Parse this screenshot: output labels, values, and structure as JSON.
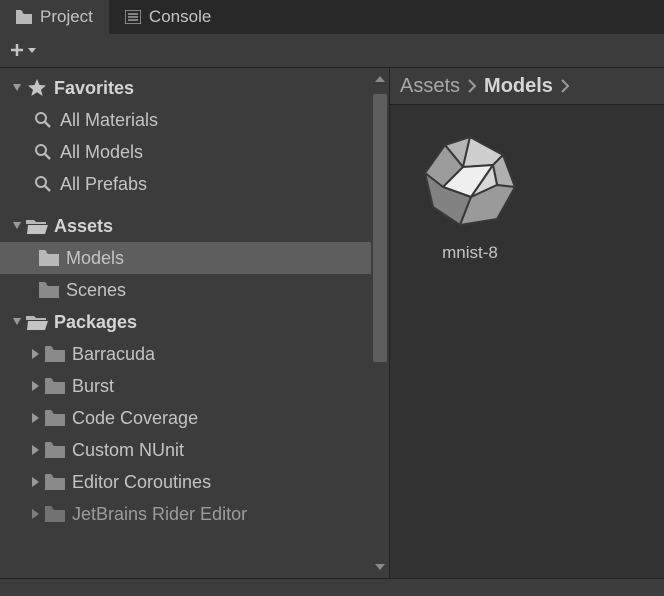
{
  "tabs": {
    "project": "Project",
    "console": "Console"
  },
  "tree": {
    "favorites": {
      "label": "Favorites",
      "items": [
        "All Materials",
        "All Models",
        "All Prefabs"
      ]
    },
    "assets": {
      "label": "Assets",
      "items": [
        "Models",
        "Scenes"
      ]
    },
    "packages": {
      "label": "Packages",
      "items": [
        "Barracuda",
        "Burst",
        "Code Coverage",
        "Custom NUnit",
        "Editor Coroutines",
        "JetBrains Rider Editor"
      ]
    }
  },
  "breadcrumb": {
    "root": "Assets",
    "current": "Models"
  },
  "content": {
    "items": [
      {
        "label": "mnist-8"
      }
    ]
  }
}
